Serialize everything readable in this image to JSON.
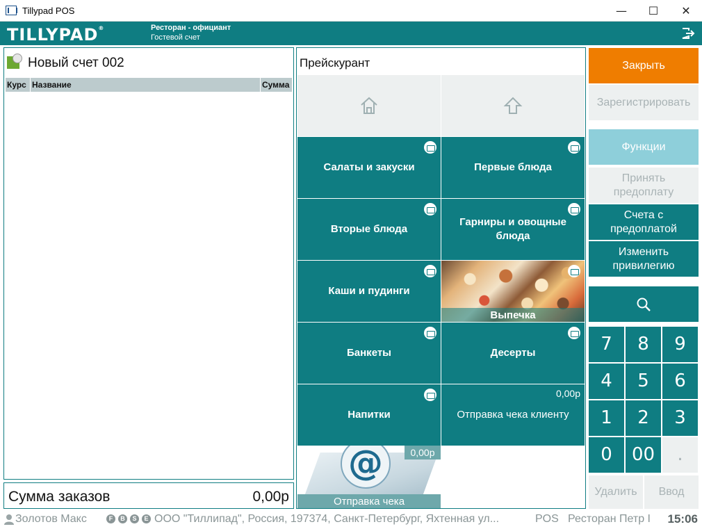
{
  "window": {
    "title": "Tillypad POS",
    "minimize": "—",
    "maximize": "☐",
    "close": "✕"
  },
  "header": {
    "logo": "TILLYPAD",
    "logo_mark": "®",
    "line1": "Ресторан - официант",
    "line2": "Гостевой счет"
  },
  "order": {
    "title": "Новый счет 002",
    "columns": [
      "Курс",
      "Название",
      "Сумма"
    ],
    "total_label": "Сумма заказов",
    "total_value": "0,00р"
  },
  "pricelist": {
    "title": "Прейскурант",
    "tiles": [
      {
        "label": "Салаты и закуски"
      },
      {
        "label": "Первые блюда"
      },
      {
        "label": "Вторые блюда"
      },
      {
        "label": "Гарниры и овощные блюда"
      },
      {
        "label": "Каши и пудинги"
      },
      {
        "label": "Выпечка"
      },
      {
        "label": "Банкеты"
      },
      {
        "label": "Десерты"
      },
      {
        "label": "Напитки"
      },
      {
        "label": "Отправка чека клиенту",
        "price": "0,00р"
      }
    ],
    "mail_tile": {
      "label": "Отправка чека",
      "price": "0,00р"
    }
  },
  "actions": {
    "close": "Закрыть",
    "register": "Зарегистрировать",
    "functions": "Функции",
    "prepay": "Принять предоплату",
    "prepaid_bills": "Счета с предоплатой",
    "privilege": "Изменить привилегию",
    "delete": "Удалить",
    "enter": "Ввод"
  },
  "keypad": [
    "7",
    "8",
    "9",
    "4",
    "5",
    "6",
    "1",
    "2",
    "3",
    "0",
    "00",
    "."
  ],
  "status": {
    "user": "Золотов Макс",
    "badges": [
      "F",
      "B",
      "S",
      "E"
    ],
    "company": "ООО \"Тиллипад\", Россия, 197374, Санкт-Петербург, Яхтенная ул...",
    "mode": "POS",
    "place": "Ресторан Петр I",
    "time": "15:06"
  },
  "colors": {
    "teal": "#0f7d82",
    "orange": "#ef7d00",
    "cyan": "#8ecfda",
    "light": "#edf0f0"
  }
}
